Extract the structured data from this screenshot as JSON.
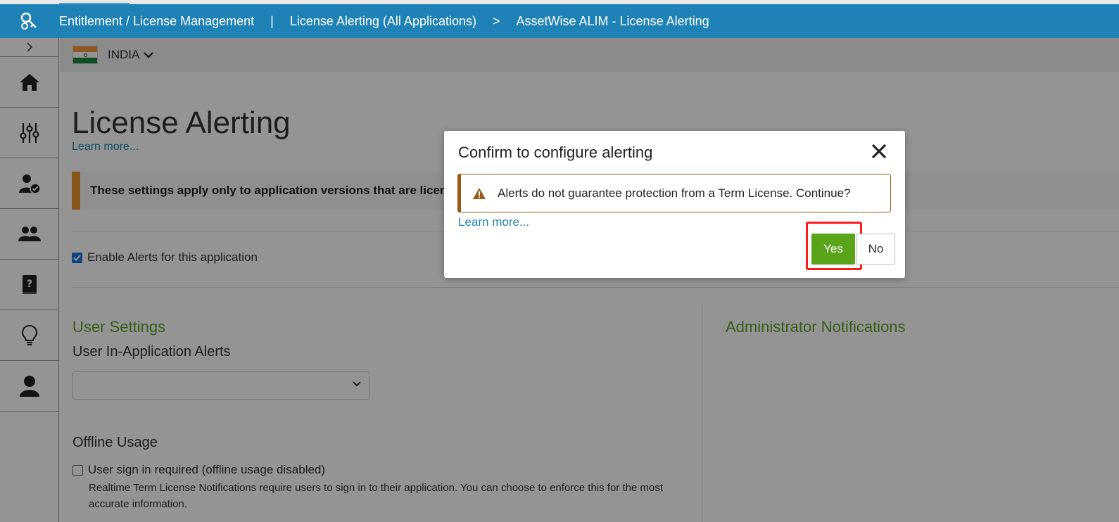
{
  "header": {
    "breadcrumbs": [
      "Entitlement / License Management",
      "License Alerting (All Applications)",
      "AssetWise ALIM - License Alerting"
    ],
    "separators": [
      "|",
      ">"
    ]
  },
  "sidebar": {
    "items": [
      {
        "icon": "home-icon"
      },
      {
        "icon": "sliders-icon"
      },
      {
        "icon": "user-check-icon"
      },
      {
        "icon": "users-icon"
      },
      {
        "icon": "help-book-icon"
      },
      {
        "icon": "lightbulb-icon"
      },
      {
        "icon": "user-icon"
      }
    ]
  },
  "region": {
    "name": "INDIA"
  },
  "main": {
    "title": "License Alerting",
    "learn_more": "Learn more...",
    "banner": "These settings apply only to application versions that are licen",
    "enable_alerts_label": "Enable Alerts for this application",
    "enable_alerts_checked": true,
    "user_settings_title": "User Settings",
    "user_in_app_alerts_label": "User In-Application Alerts",
    "user_in_app_alerts_value": "",
    "offline_usage_title": "Offline Usage",
    "offline_checkbox_label": "User sign in required (offline usage disabled)",
    "offline_checkbox_checked": false,
    "offline_description": "Realtime Term License Notifications require users to sign in to their application. You can choose to enforce this for the most accurate information.",
    "admin_notifications_title": "Administrator Notifications"
  },
  "modal": {
    "title": "Confirm to configure alerting",
    "alert_text": "Alerts do not guarantee protection from a Term License. Continue?",
    "learn_more": "Learn more...",
    "yes_label": "Yes",
    "no_label": "No"
  },
  "colors": {
    "brand_blue": "#1f82b6",
    "accent_green": "#5aa41a",
    "warning_orange": "#e8962e",
    "highlight_red": "#ff1a1a"
  }
}
